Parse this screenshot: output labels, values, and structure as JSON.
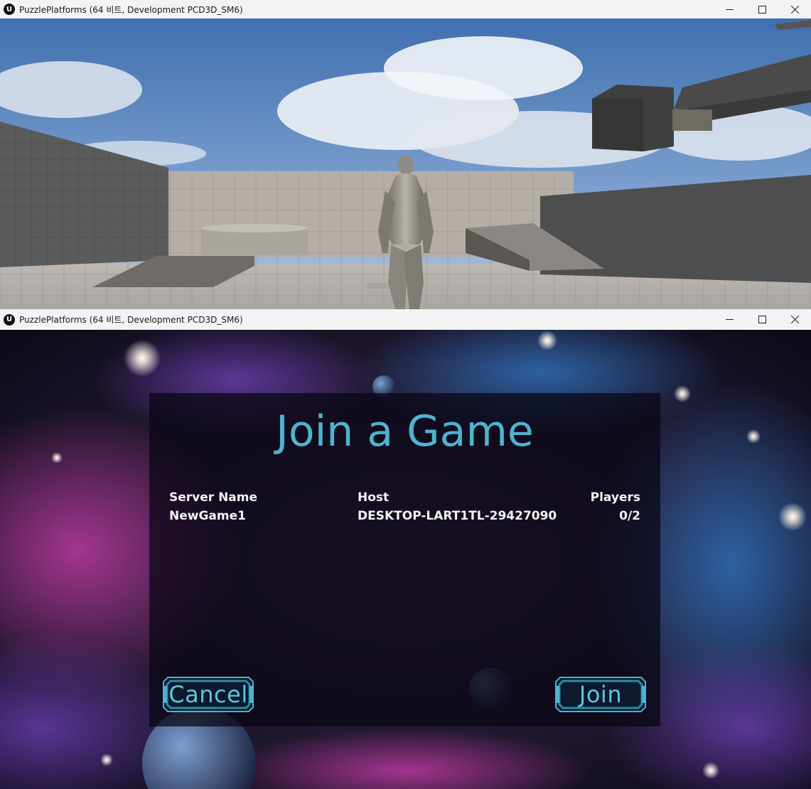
{
  "top_window": {
    "title": "PuzzlePlatforms (64 비트, Development PCD3D_SM6)",
    "logo_glyph": "U",
    "controls": [
      "minimize-icon",
      "maximize-icon",
      "close-icon"
    ]
  },
  "bottom_window": {
    "title": "PuzzlePlatforms (64 비트, Development PCD3D_SM6)",
    "logo_glyph": "U",
    "controls": [
      "minimize-icon",
      "maximize-icon",
      "close-icon"
    ]
  },
  "menu": {
    "title": "Join a Game",
    "columns": {
      "server_name": "Server Name",
      "host": "Host",
      "players": "Players"
    },
    "servers": [
      {
        "server_name": "NewGame1",
        "host": "DESKTOP-LART1TL-29427090",
        "players": "0/2"
      }
    ],
    "cancel_label": "Cancel",
    "join_label": "Join"
  },
  "colors": {
    "accent": "#4fb3cf",
    "button_text": "#60c4dd",
    "titlebar": "#f3f3f3"
  }
}
